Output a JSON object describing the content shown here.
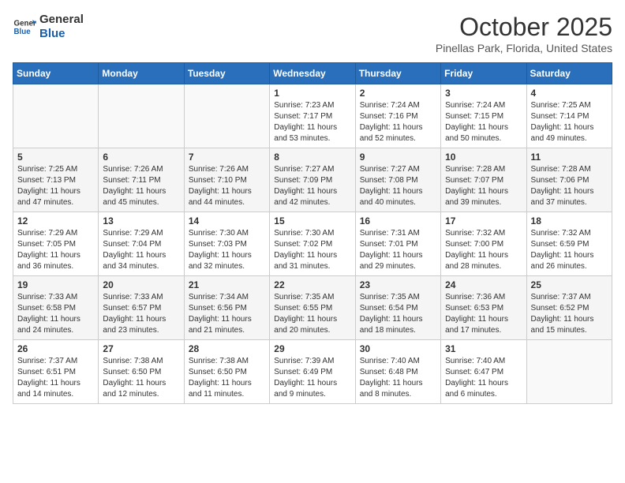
{
  "logo": {
    "general": "General",
    "blue": "Blue"
  },
  "header": {
    "title": "October 2025",
    "subtitle": "Pinellas Park, Florida, United States"
  },
  "weekdays": [
    "Sunday",
    "Monday",
    "Tuesday",
    "Wednesday",
    "Thursday",
    "Friday",
    "Saturday"
  ],
  "weeks": [
    [
      {
        "day": "",
        "info": ""
      },
      {
        "day": "",
        "info": ""
      },
      {
        "day": "",
        "info": ""
      },
      {
        "day": "1",
        "info": "Sunrise: 7:23 AM\nSunset: 7:17 PM\nDaylight: 11 hours\nand 53 minutes."
      },
      {
        "day": "2",
        "info": "Sunrise: 7:24 AM\nSunset: 7:16 PM\nDaylight: 11 hours\nand 52 minutes."
      },
      {
        "day": "3",
        "info": "Sunrise: 7:24 AM\nSunset: 7:15 PM\nDaylight: 11 hours\nand 50 minutes."
      },
      {
        "day": "4",
        "info": "Sunrise: 7:25 AM\nSunset: 7:14 PM\nDaylight: 11 hours\nand 49 minutes."
      }
    ],
    [
      {
        "day": "5",
        "info": "Sunrise: 7:25 AM\nSunset: 7:13 PM\nDaylight: 11 hours\nand 47 minutes."
      },
      {
        "day": "6",
        "info": "Sunrise: 7:26 AM\nSunset: 7:11 PM\nDaylight: 11 hours\nand 45 minutes."
      },
      {
        "day": "7",
        "info": "Sunrise: 7:26 AM\nSunset: 7:10 PM\nDaylight: 11 hours\nand 44 minutes."
      },
      {
        "day": "8",
        "info": "Sunrise: 7:27 AM\nSunset: 7:09 PM\nDaylight: 11 hours\nand 42 minutes."
      },
      {
        "day": "9",
        "info": "Sunrise: 7:27 AM\nSunset: 7:08 PM\nDaylight: 11 hours\nand 40 minutes."
      },
      {
        "day": "10",
        "info": "Sunrise: 7:28 AM\nSunset: 7:07 PM\nDaylight: 11 hours\nand 39 minutes."
      },
      {
        "day": "11",
        "info": "Sunrise: 7:28 AM\nSunset: 7:06 PM\nDaylight: 11 hours\nand 37 minutes."
      }
    ],
    [
      {
        "day": "12",
        "info": "Sunrise: 7:29 AM\nSunset: 7:05 PM\nDaylight: 11 hours\nand 36 minutes."
      },
      {
        "day": "13",
        "info": "Sunrise: 7:29 AM\nSunset: 7:04 PM\nDaylight: 11 hours\nand 34 minutes."
      },
      {
        "day": "14",
        "info": "Sunrise: 7:30 AM\nSunset: 7:03 PM\nDaylight: 11 hours\nand 32 minutes."
      },
      {
        "day": "15",
        "info": "Sunrise: 7:30 AM\nSunset: 7:02 PM\nDaylight: 11 hours\nand 31 minutes."
      },
      {
        "day": "16",
        "info": "Sunrise: 7:31 AM\nSunset: 7:01 PM\nDaylight: 11 hours\nand 29 minutes."
      },
      {
        "day": "17",
        "info": "Sunrise: 7:32 AM\nSunset: 7:00 PM\nDaylight: 11 hours\nand 28 minutes."
      },
      {
        "day": "18",
        "info": "Sunrise: 7:32 AM\nSunset: 6:59 PM\nDaylight: 11 hours\nand 26 minutes."
      }
    ],
    [
      {
        "day": "19",
        "info": "Sunrise: 7:33 AM\nSunset: 6:58 PM\nDaylight: 11 hours\nand 24 minutes."
      },
      {
        "day": "20",
        "info": "Sunrise: 7:33 AM\nSunset: 6:57 PM\nDaylight: 11 hours\nand 23 minutes."
      },
      {
        "day": "21",
        "info": "Sunrise: 7:34 AM\nSunset: 6:56 PM\nDaylight: 11 hours\nand 21 minutes."
      },
      {
        "day": "22",
        "info": "Sunrise: 7:35 AM\nSunset: 6:55 PM\nDaylight: 11 hours\nand 20 minutes."
      },
      {
        "day": "23",
        "info": "Sunrise: 7:35 AM\nSunset: 6:54 PM\nDaylight: 11 hours\nand 18 minutes."
      },
      {
        "day": "24",
        "info": "Sunrise: 7:36 AM\nSunset: 6:53 PM\nDaylight: 11 hours\nand 17 minutes."
      },
      {
        "day": "25",
        "info": "Sunrise: 7:37 AM\nSunset: 6:52 PM\nDaylight: 11 hours\nand 15 minutes."
      }
    ],
    [
      {
        "day": "26",
        "info": "Sunrise: 7:37 AM\nSunset: 6:51 PM\nDaylight: 11 hours\nand 14 minutes."
      },
      {
        "day": "27",
        "info": "Sunrise: 7:38 AM\nSunset: 6:50 PM\nDaylight: 11 hours\nand 12 minutes."
      },
      {
        "day": "28",
        "info": "Sunrise: 7:38 AM\nSunset: 6:50 PM\nDaylight: 11 hours\nand 11 minutes."
      },
      {
        "day": "29",
        "info": "Sunrise: 7:39 AM\nSunset: 6:49 PM\nDaylight: 11 hours\nand 9 minutes."
      },
      {
        "day": "30",
        "info": "Sunrise: 7:40 AM\nSunset: 6:48 PM\nDaylight: 11 hours\nand 8 minutes."
      },
      {
        "day": "31",
        "info": "Sunrise: 7:40 AM\nSunset: 6:47 PM\nDaylight: 11 hours\nand 6 minutes."
      },
      {
        "day": "",
        "info": ""
      }
    ]
  ]
}
